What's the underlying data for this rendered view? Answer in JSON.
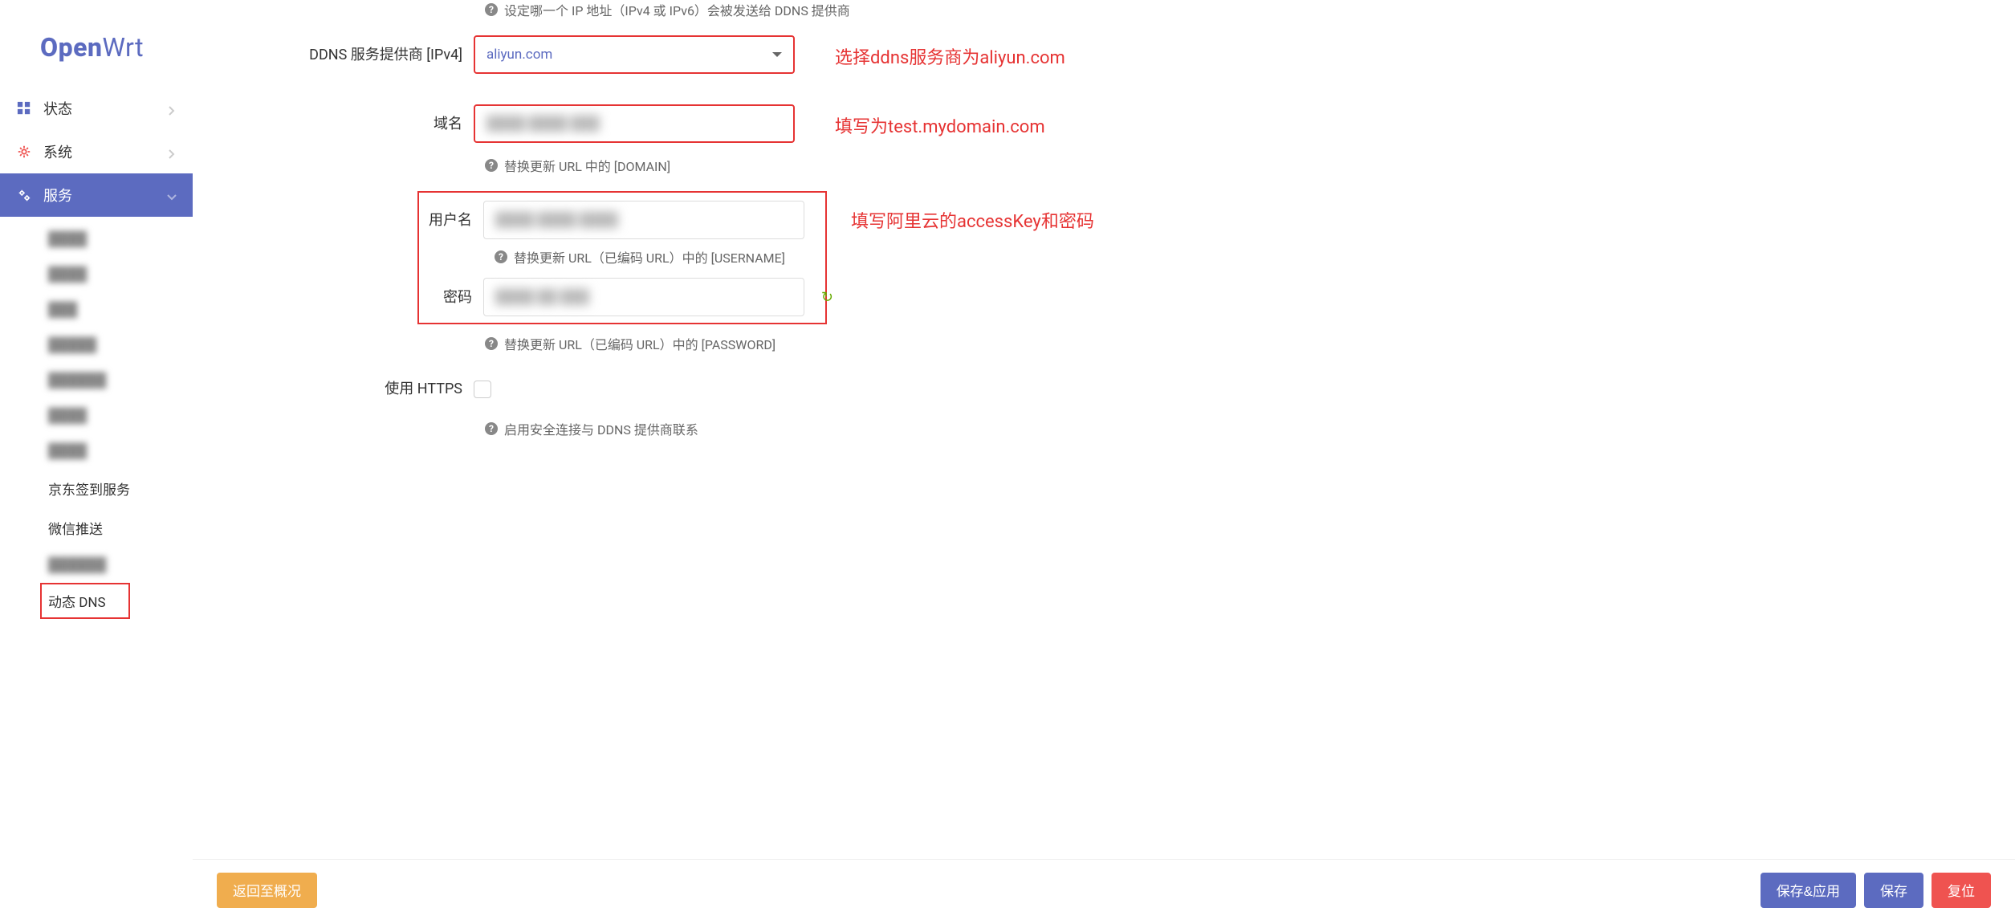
{
  "brand": {
    "part1": "Open",
    "part2": "Wrt"
  },
  "sidebar": {
    "items": [
      {
        "label": "状态",
        "icon": "dashboard"
      },
      {
        "label": "系统",
        "icon": "gear"
      },
      {
        "label": "服务",
        "icon": "gears",
        "active": true
      }
    ],
    "sub": [
      {
        "label": "京东签到服务"
      },
      {
        "label": "微信推送"
      },
      {
        "label": "动态 DNS",
        "boxed": true
      }
    ]
  },
  "form": {
    "ip_hint": "设定哪一个 IP 地址（IPv4 或 IPv6）会被发送给 DDNS 提供商",
    "provider_label": "DDNS 服务提供商 [IPv4]",
    "provider_value": "aliyun.com",
    "provider_annot": "选择ddns服务商为aliyun.com",
    "domain_label": "域名",
    "domain_value": "",
    "domain_hint": "替换更新 URL 中的 [DOMAIN]",
    "domain_annot": "填写为test.mydomain.com",
    "username_label": "用户名",
    "username_value": "",
    "username_hint": "替换更新 URL（已编码 URL）中的 [USERNAME]",
    "password_label": "密码",
    "password_value": "",
    "password_hint": "替换更新 URL（已编码 URL）中的 [PASSWORD]",
    "userpass_annot": "填写阿里云的accessKey和密码",
    "https_label": "使用 HTTPS",
    "https_hint": "启用安全连接与 DDNS 提供商联系"
  },
  "footer": {
    "back": "返回至概况",
    "save_apply": "保存&应用",
    "save": "保存",
    "reset": "复位"
  }
}
